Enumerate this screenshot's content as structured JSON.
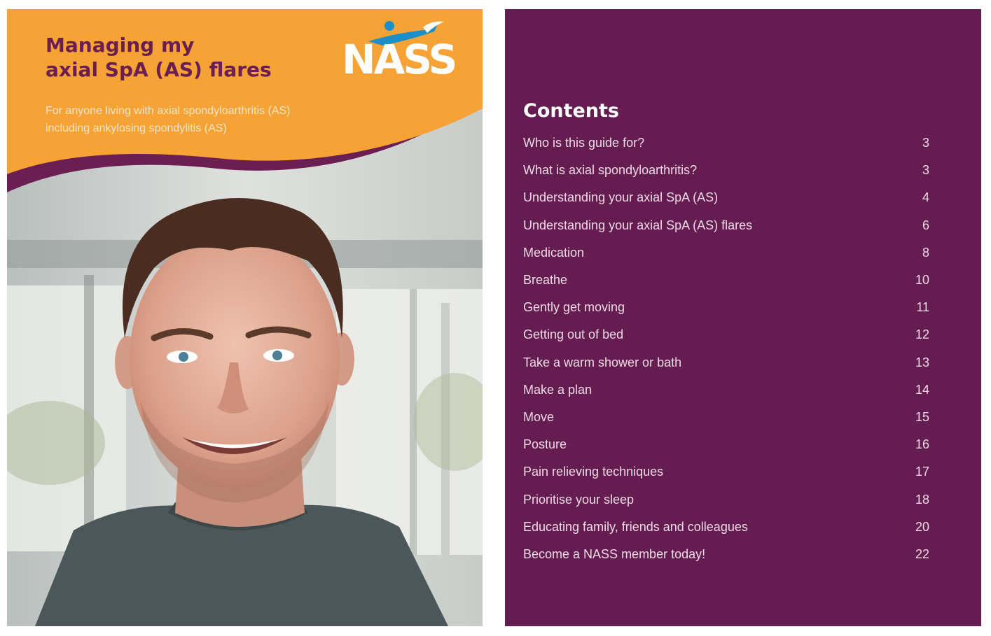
{
  "cover": {
    "title_line1": "Managing my",
    "title_line2": "axial SpA (AS) flares",
    "subtitle_line1": "For anyone living with axial spondyloarthritis (AS)",
    "subtitle_line2": "including ankylosing spondylitis (AS)",
    "logo_text": "NASS",
    "colors": {
      "banner": "#f6a234",
      "wave": "#6a1e52",
      "title": "#6a1e52",
      "logo_accent": "#1b8fc9"
    }
  },
  "contents": {
    "heading": "Contents",
    "background": "#651c50",
    "entries": [
      {
        "label": "Who is this guide for?",
        "page": "3"
      },
      {
        "label": "What is axial spondyloarthritis?",
        "page": "3"
      },
      {
        "label": "Understanding your axial SpA (AS)",
        "page": "4"
      },
      {
        "label": "Understanding your axial SpA (AS) flares",
        "page": "6"
      },
      {
        "label": "Medication",
        "page": "8"
      },
      {
        "label": "Breathe",
        "page": "10"
      },
      {
        "label": "Gently get moving",
        "page": "11"
      },
      {
        "label": "Getting out of bed",
        "page": "12"
      },
      {
        "label": "Take a warm shower or bath",
        "page": "13"
      },
      {
        "label": "Make a plan",
        "page": "14"
      },
      {
        "label": "Move",
        "page": "15"
      },
      {
        "label": "Posture",
        "page": "16"
      },
      {
        "label": "Pain relieving techniques",
        "page": "17"
      },
      {
        "label": "Prioritise your sleep",
        "page": "18"
      },
      {
        "label": "Educating family, friends and colleagues",
        "page": "20"
      },
      {
        "label": "Become a NASS member today!",
        "page": "22"
      }
    ]
  }
}
